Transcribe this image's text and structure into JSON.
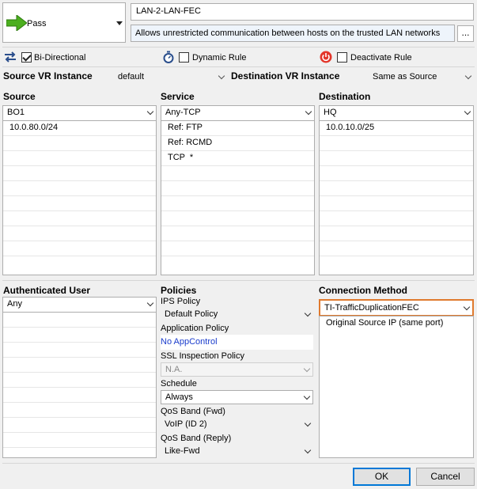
{
  "action": {
    "label": "Pass"
  },
  "rule": {
    "name": "LAN-2-LAN-FEC",
    "comment": "Allows unrestricted communication between hosts on the trusted LAN networks",
    "comment_button": "..."
  },
  "options": {
    "bidirectional": "Bi-Directional",
    "dynamic_rule": "Dynamic Rule",
    "deactivate_rule": "Deactivate Rule"
  },
  "vr": {
    "source_label": "Source VR Instance",
    "source_value": "default",
    "dest_label": "Destination VR Instance",
    "dest_value": "Same as Source"
  },
  "source": {
    "label": "Source",
    "selected": "BO1",
    "items": [
      "10.0.80.0/24"
    ]
  },
  "service": {
    "label": "Service",
    "selected": "Any-TCP",
    "items": [
      "Ref: FTP",
      "Ref: RCMD",
      "TCP  *"
    ]
  },
  "destination": {
    "label": "Destination",
    "selected": "HQ",
    "items": [
      "10.0.10.0/25"
    ]
  },
  "auth": {
    "label": "Authenticated User",
    "selected": "Any"
  },
  "policies": {
    "label": "Policies",
    "ips_label": "IPS Policy",
    "ips_value": "Default Policy",
    "app_label": "Application Policy",
    "app_value": "No AppControl",
    "ssl_label": "SSL Inspection Policy",
    "ssl_value": "N.A.",
    "schedule_label": "Schedule",
    "schedule_value": "Always",
    "qos_fwd_label": "QoS Band (Fwd)",
    "qos_fwd_value": "VoIP (ID 2)",
    "qos_reply_label": "QoS Band (Reply)",
    "qos_reply_value": "Like-Fwd"
  },
  "connection": {
    "label": "Connection Method",
    "selected": "TI-TrafficDuplicationFEC",
    "items": [
      "Original Source IP (same port)"
    ],
    "accent": "#e07a2e"
  },
  "buttons": {
    "ok": "OK",
    "cancel": "Cancel"
  }
}
